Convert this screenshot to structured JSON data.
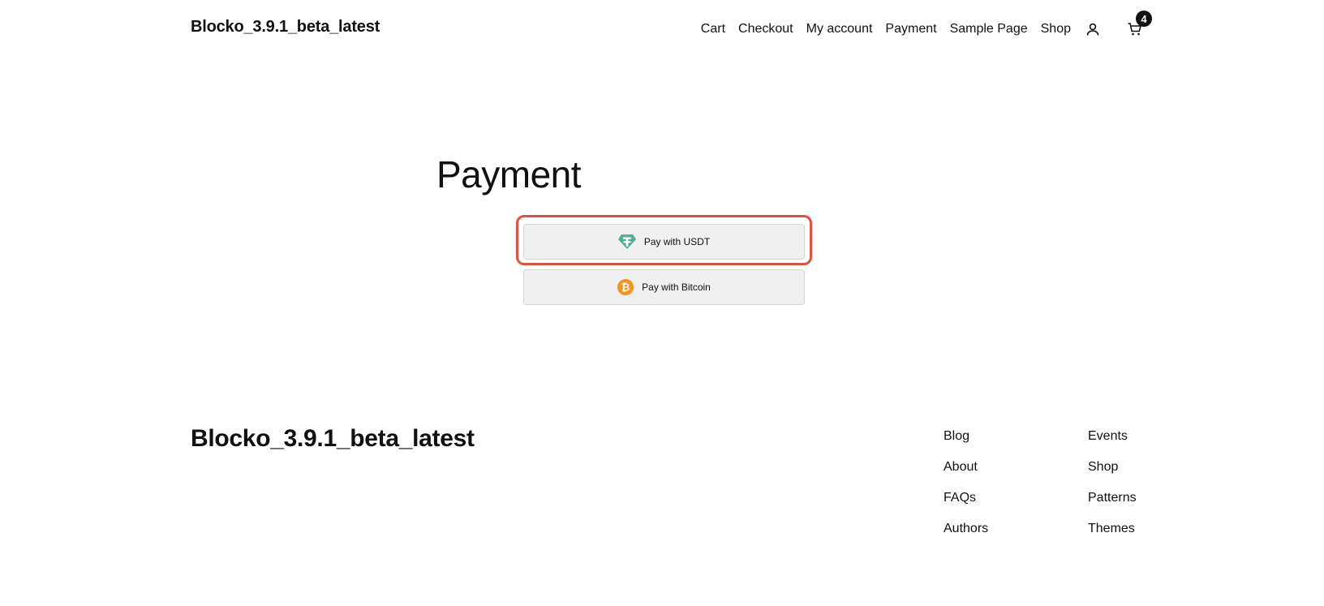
{
  "header": {
    "site_title": "Blocko_3.9.1_beta_latest",
    "nav": [
      "Cart",
      "Checkout",
      "My account",
      "Payment",
      "Sample Page",
      "Shop"
    ],
    "account_icon": "user-icon",
    "cart_icon": "cart-icon",
    "cart_count": "4"
  },
  "main": {
    "title": "Payment",
    "buttons": {
      "usdt": {
        "label": "Pay with USDT",
        "icon": "tether-icon",
        "color": "#50af95"
      },
      "bitcoin": {
        "label": "Pay with Bitcoin",
        "icon": "bitcoin-icon",
        "color": "#f7931a"
      }
    },
    "highlight_color": "#e0523e"
  },
  "footer": {
    "site_title": "Blocko_3.9.1_beta_latest",
    "col1": [
      "Blog",
      "About",
      "FAQs",
      "Authors"
    ],
    "col2": [
      "Events",
      "Shop",
      "Patterns",
      "Themes"
    ]
  }
}
